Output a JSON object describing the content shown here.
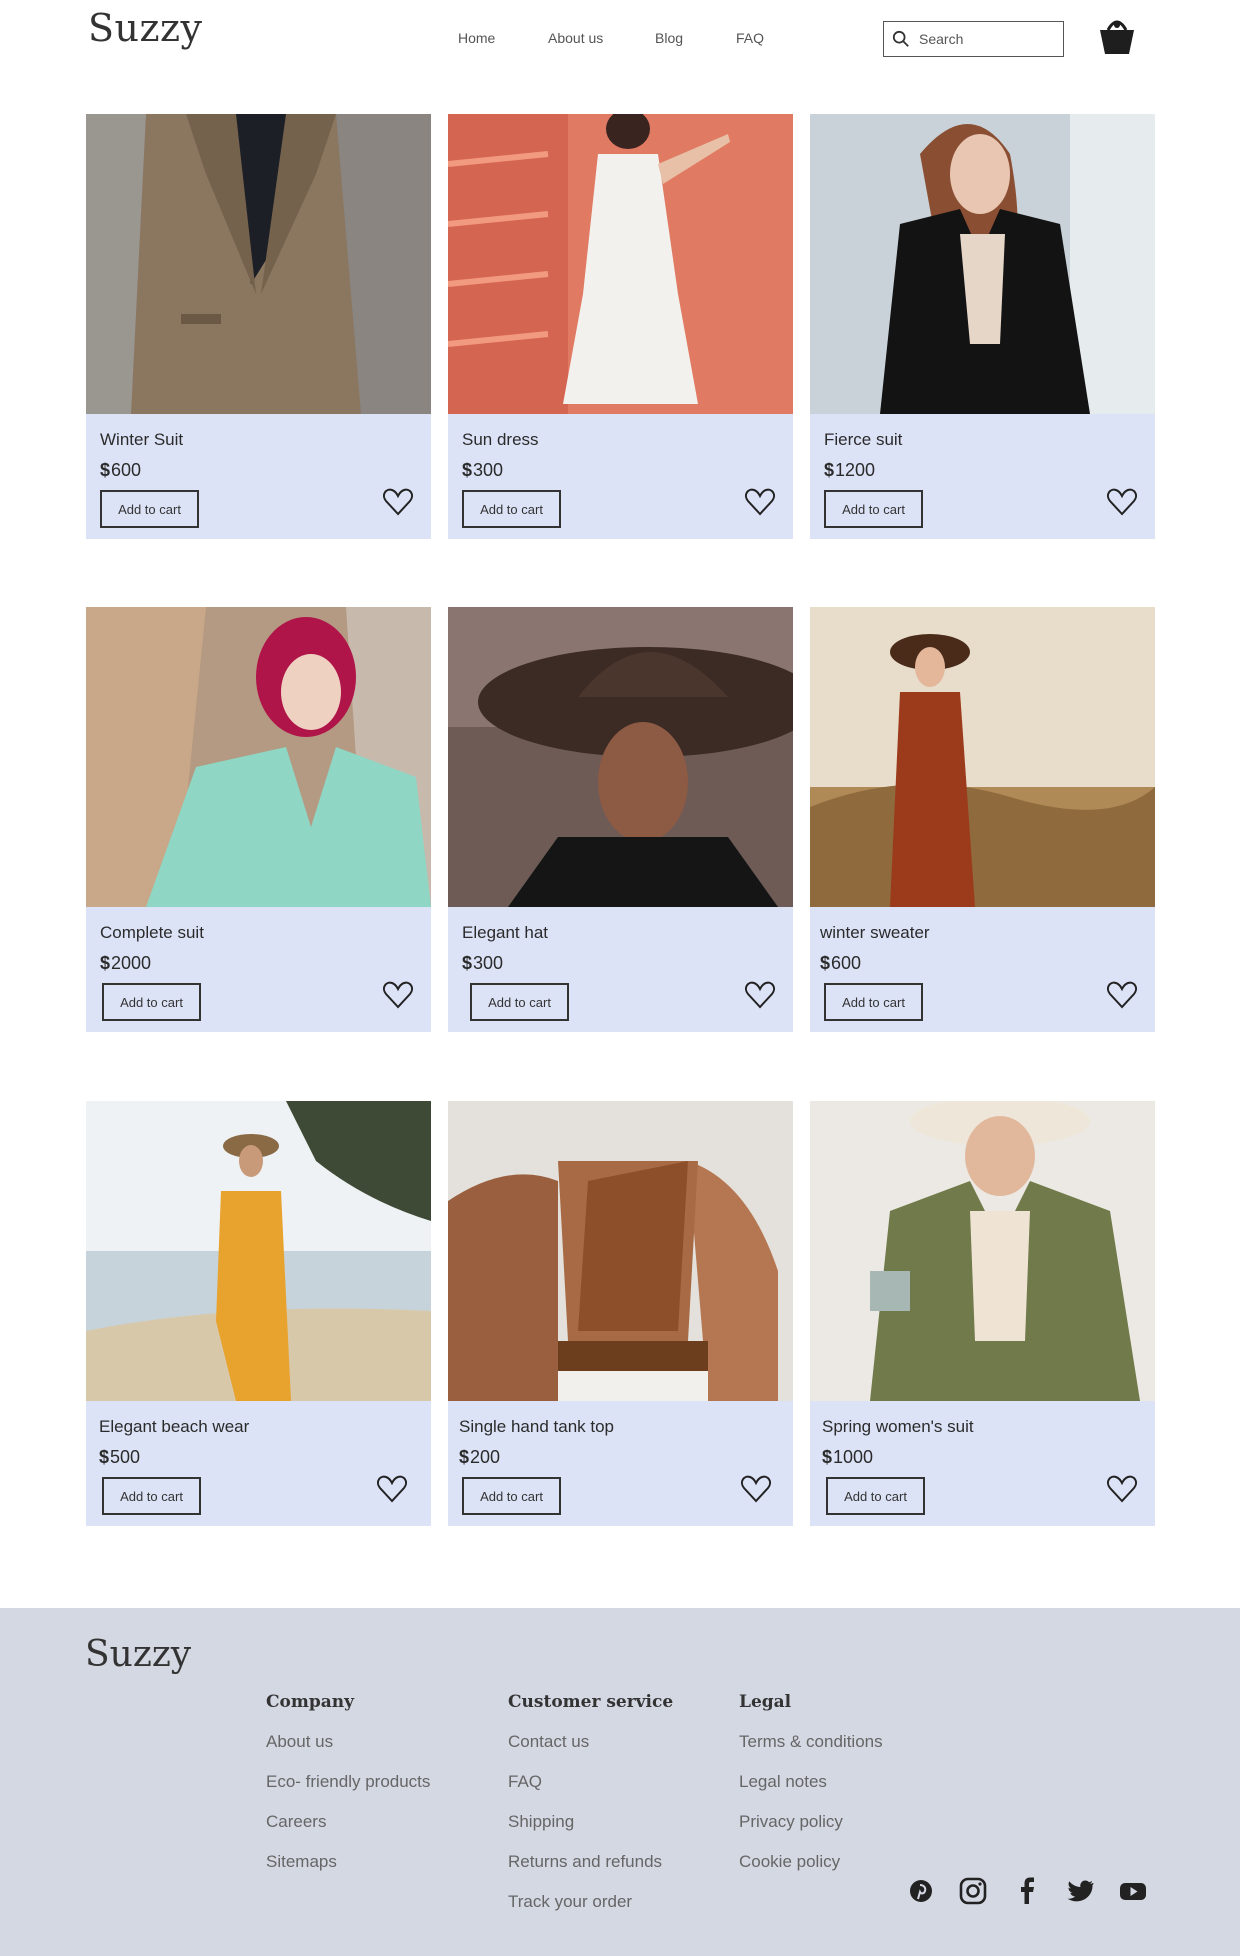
{
  "brand": "Suzzy",
  "nav": [
    "Home",
    "About us",
    "Blog",
    "FAQ"
  ],
  "search": {
    "placeholder": "Search"
  },
  "currency": "$",
  "add_label": "Add to cart",
  "products": [
    {
      "name": "Winter Suit",
      "price": "600"
    },
    {
      "name": "Sun dress",
      "price": "300"
    },
    {
      "name": "Fierce suit",
      "price": "1200"
    },
    {
      "name": "Complete suit",
      "price": "2000"
    },
    {
      "name": "Elegant hat",
      "price": "300"
    },
    {
      "name": "winter sweater",
      "price": "600"
    },
    {
      "name": "Elegant beach wear",
      "price": "500"
    },
    {
      "name": "Single hand tank top",
      "price": "200"
    },
    {
      "name": "Spring women's suit",
      "price": "1000"
    }
  ],
  "footer": {
    "brand": "Suzzy",
    "columns": [
      {
        "title": "Company",
        "links": [
          "About us",
          "Eco- friendly products",
          "Careers",
          "Sitemaps"
        ]
      },
      {
        "title": "Customer service",
        "links": [
          "Contact us",
          "FAQ",
          "Shipping",
          "Returns and refunds",
          "Track your order"
        ]
      },
      {
        "title": "Legal",
        "links": [
          "Terms & conditions",
          "Legal notes",
          "Privacy policy",
          "Cookie policy"
        ]
      }
    ],
    "social": [
      "pinterest-icon",
      "instagram-icon",
      "facebook-icon",
      "twitter-icon",
      "youtube-icon"
    ]
  },
  "colors": {
    "card_bg": "#dde3f7",
    "footer_bg": "#d4d8e3",
    "text": "#2b2b2b"
  }
}
